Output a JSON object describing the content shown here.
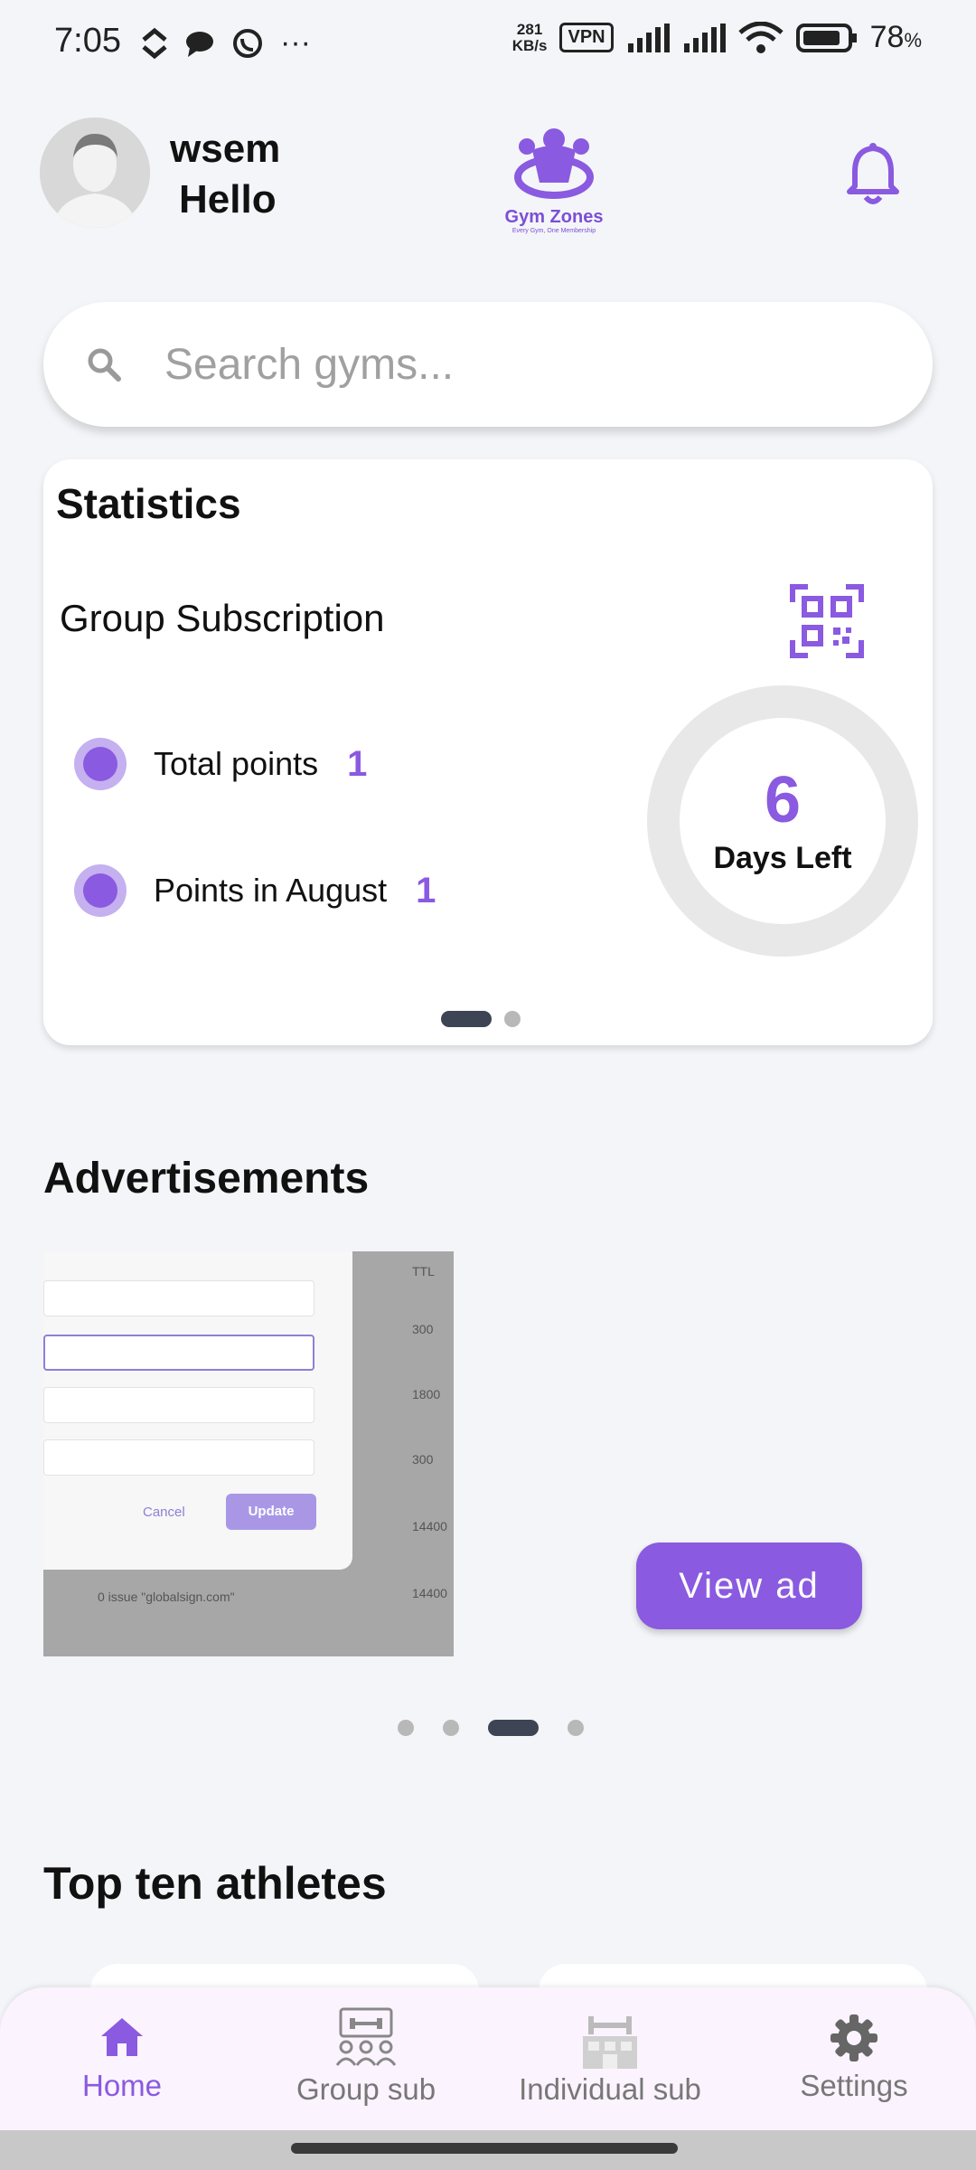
{
  "status_bar": {
    "time": "7:05",
    "speed_value": "281",
    "speed_unit": "KB/s",
    "vpn": "VPN",
    "battery": "78",
    "battery_unit": "%",
    "overflow": "···"
  },
  "header": {
    "user_name": "wsem",
    "greeting": "Hello",
    "logo_title": "Gym Zones",
    "logo_subtitle": "Every Gym, One Membership"
  },
  "search": {
    "placeholder": "Search gyms..."
  },
  "statistics": {
    "title": "Statistics",
    "subscription_type": "Group Subscription",
    "rows": [
      {
        "label": "Total points",
        "value": "1"
      },
      {
        "label": "Points in August",
        "value": "1"
      }
    ],
    "days_left_number": "6",
    "days_left_label": "Days Left",
    "pager": {
      "count": 2,
      "active": 0
    }
  },
  "advertisements": {
    "title": "Advertisements",
    "view_button": "View ad",
    "ad_preview": {
      "column_header": "TTL",
      "column_values": [
        "300",
        "1800",
        "300",
        "14400",
        "14400"
      ],
      "cancel_label": "Cancel",
      "update_label": "Update",
      "note": "0 issue \"globalsign.com\""
    },
    "pager": {
      "count": 4,
      "active": 2
    }
  },
  "athletes": {
    "title": "Top ten athletes"
  },
  "bottom_nav": {
    "items": [
      {
        "label": "Home",
        "active": true
      },
      {
        "label": "Group sub",
        "active": false
      },
      {
        "label": "Individual sub",
        "active": false
      },
      {
        "label": "Settings",
        "active": false
      }
    ]
  },
  "colors": {
    "accent": "#8a5ae0",
    "background": "#f4f5f8",
    "pager_active": "#3d4453"
  }
}
